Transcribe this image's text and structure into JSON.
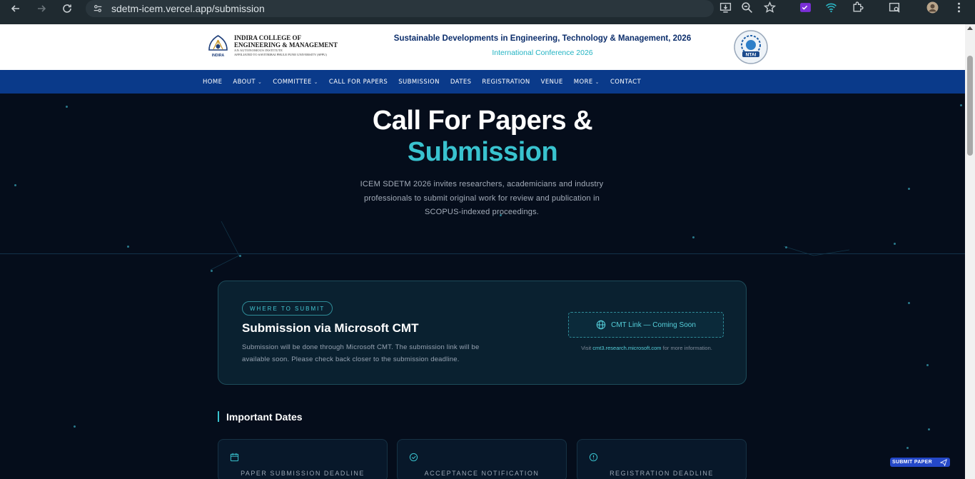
{
  "browser": {
    "url": "sdetm-icem.vercel.app/submission"
  },
  "header": {
    "college_line1": "INDIRA COLLEGE OF",
    "college_line2": "ENGINEERING & MANAGEMENT",
    "college_line3": "AN AUTONOMOUS INSTITUTE",
    "college_line4": "AFFILIATED TO SAVITRIBAI PHULE PUNE UNIVERSITY (SPPU)",
    "logo_caption": "INDIRA",
    "conference_title": "Sustainable Developments in Engineering, Technology & Management, 2026",
    "conference_subtitle": "International Conference 2026",
    "ntai_label": "NTAI"
  },
  "nav": {
    "items": [
      {
        "label": "HOME",
        "dropdown": false
      },
      {
        "label": "ABOUT",
        "dropdown": true
      },
      {
        "label": "COMMITTEE",
        "dropdown": true
      },
      {
        "label": "CALL FOR PAPERS",
        "dropdown": false
      },
      {
        "label": "SUBMISSION",
        "dropdown": false
      },
      {
        "label": "DATES",
        "dropdown": false
      },
      {
        "label": "REGISTRATION",
        "dropdown": false
      },
      {
        "label": "VENUE",
        "dropdown": false
      },
      {
        "label": "MORE",
        "dropdown": true
      },
      {
        "label": "CONTACT",
        "dropdown": false
      }
    ],
    "dropdown_glyph": "⌄"
  },
  "hero": {
    "title_line1": "Call For Papers &",
    "title_line2": "Submission",
    "description": "ICEM SDETM 2026 invites researchers, academicians and industry professionals to submit original work for review and publication in SCOPUS-indexed proceedings."
  },
  "submission": {
    "badge": "WHERE TO SUBMIT",
    "title": "Submission via Microsoft CMT",
    "text": "Submission will be done through Microsoft CMT. The submission link will be available soon. Please check back closer to the submission deadline.",
    "cmt_button": "CMT Link — Coming Soon",
    "note_prefix": "Visit ",
    "note_link": "cmt3.research.microsoft.com",
    "note_suffix": " for more information."
  },
  "dates": {
    "heading": "Important Dates",
    "cards": [
      {
        "label": "PAPER SUBMISSION DEADLINE",
        "icon": "calendar-icon"
      },
      {
        "label": "ACCEPTANCE NOTIFICATION",
        "icon": "check-circle-icon"
      },
      {
        "label": "REGISTRATION DEADLINE",
        "icon": "alert-circle-icon"
      }
    ]
  },
  "floating": {
    "submit_label": "SUBMIT PAPER",
    "icon": "send-icon"
  },
  "colors": {
    "accent": "#39c3cf",
    "nav_bg": "#0a3a8a",
    "page_bg": "#050d1b",
    "float_btn": "#2448c8"
  }
}
